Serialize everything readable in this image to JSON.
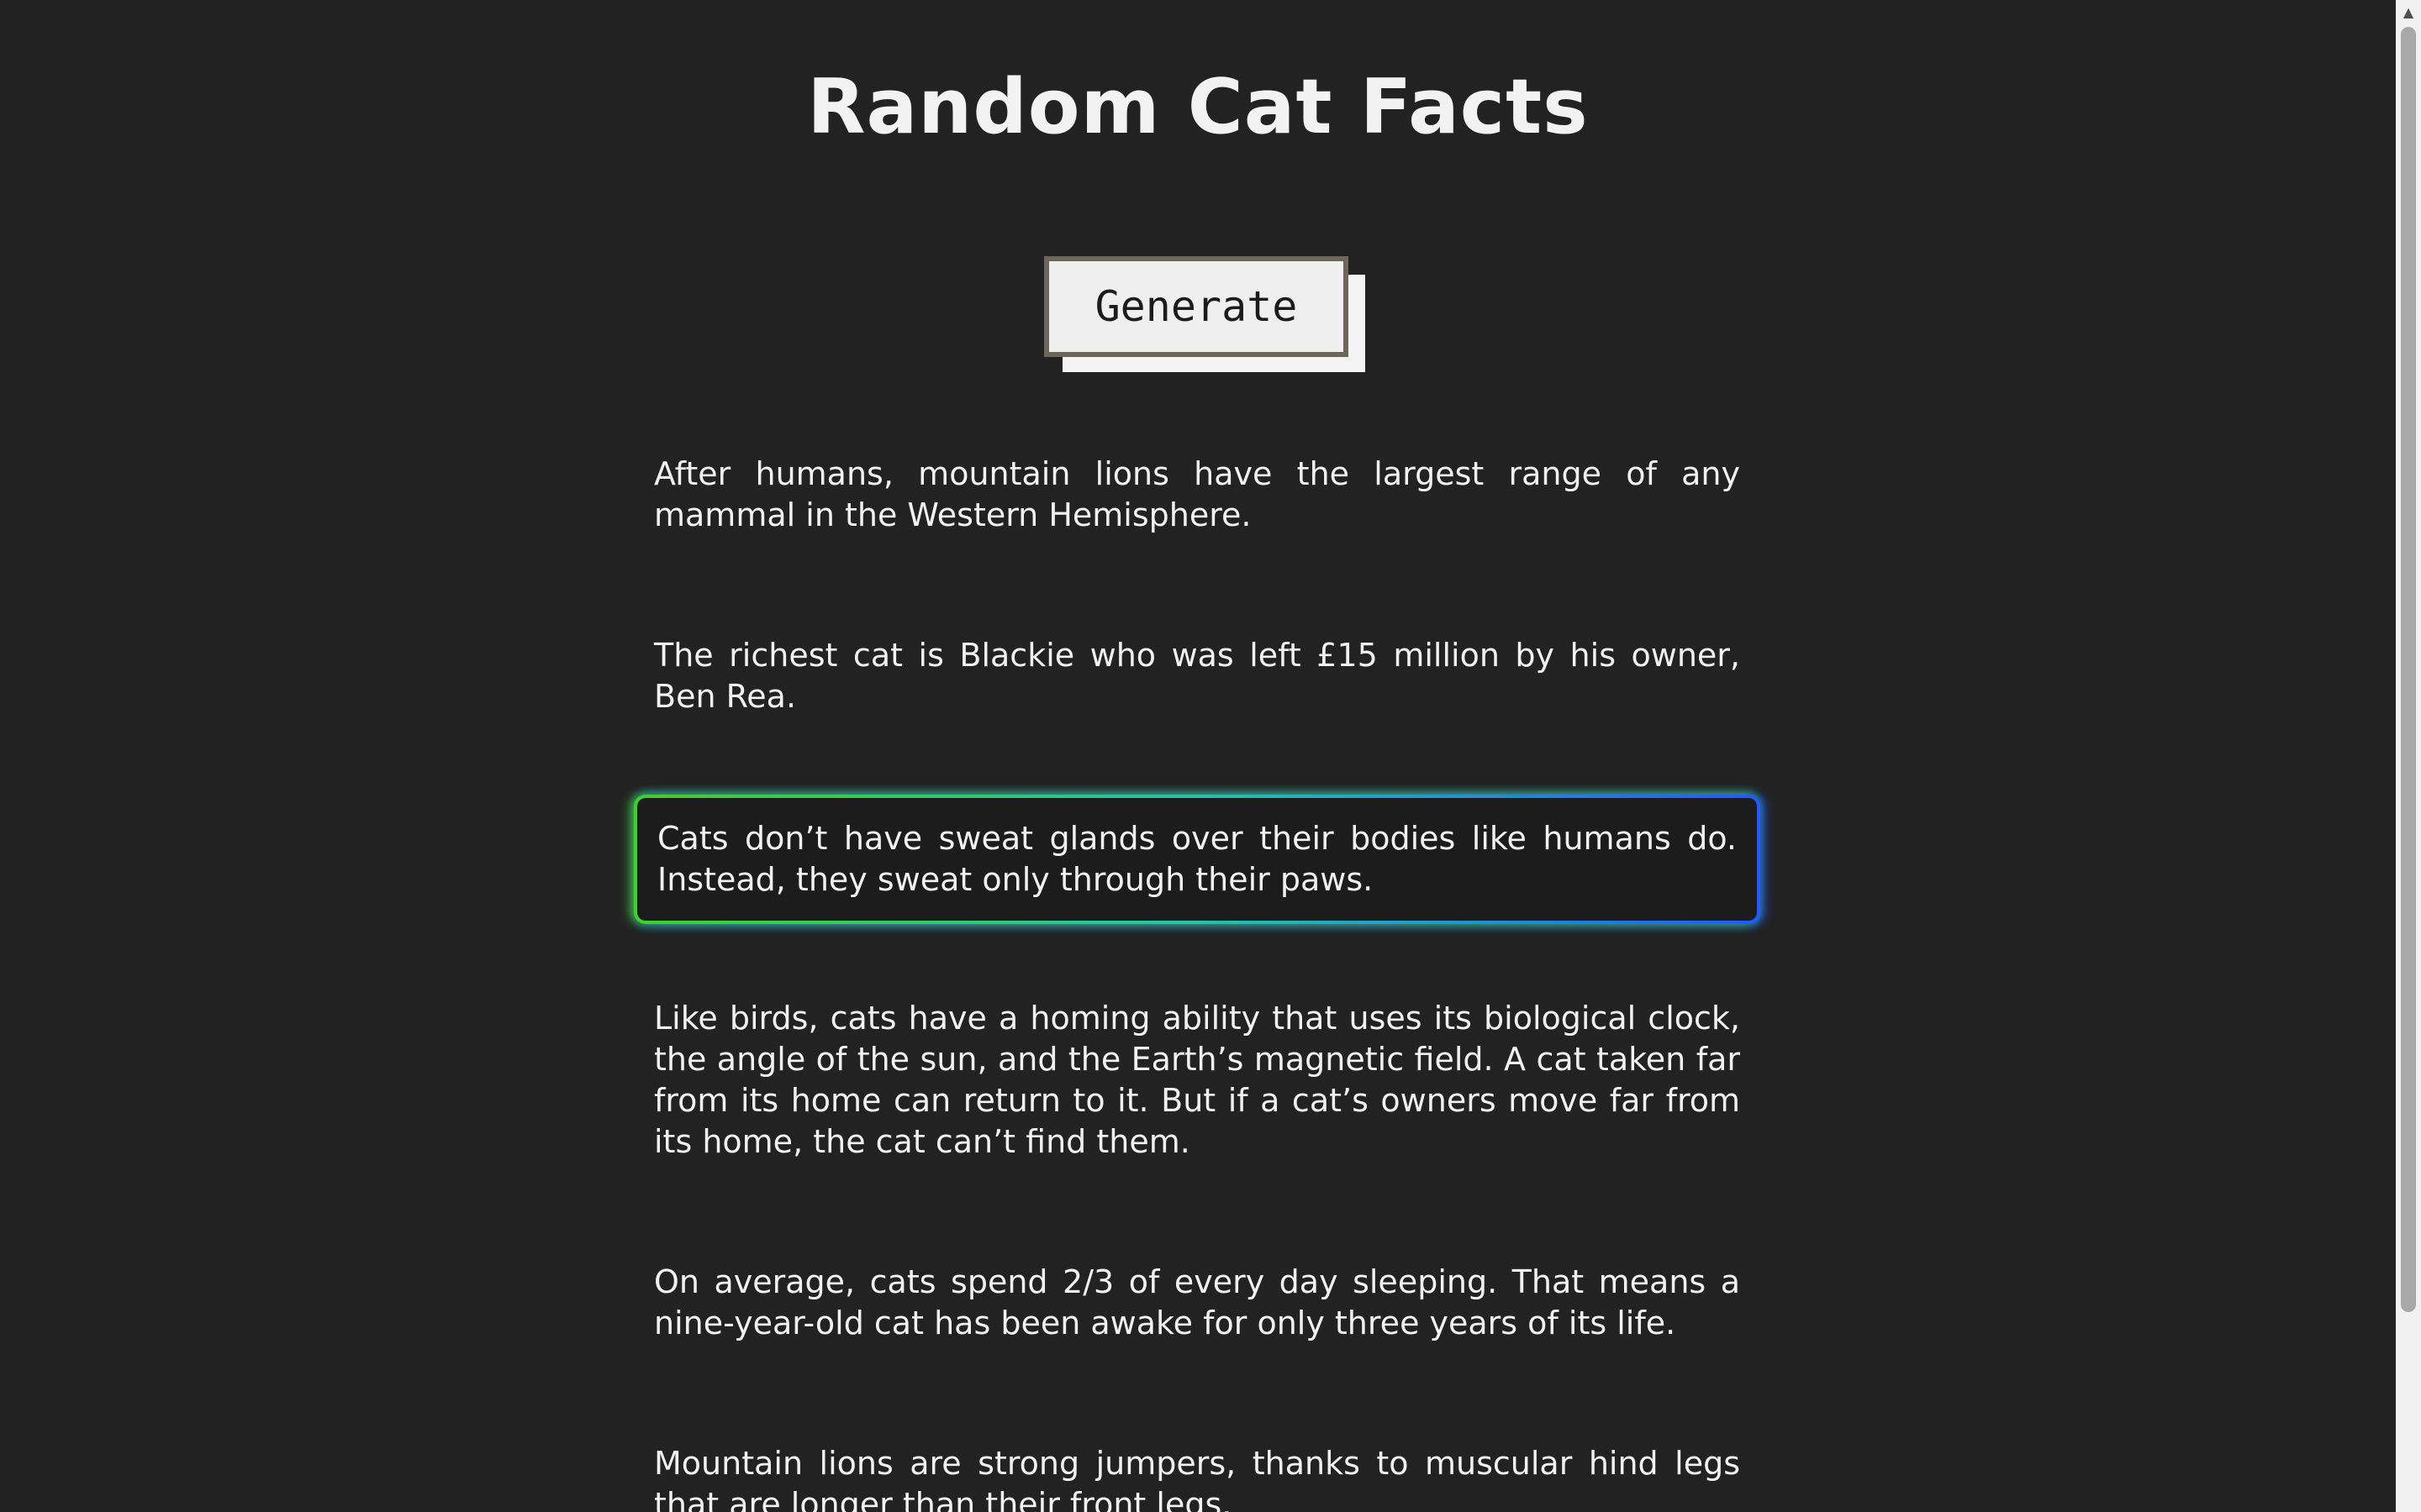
{
  "header": {
    "title": "Random Cat Facts"
  },
  "controls": {
    "generate_label": "Generate"
  },
  "facts": [
    "After humans, mountain lions have the largest range of any mammal in the Western Hemisphere.",
    "The richest cat is Blackie who was left £15 million by his owner, Ben Rea.",
    "Cats don’t have sweat glands over their bodies like humans do. Instead, they sweat only through their paws.",
    "Like birds, cats have a homing ability that uses its biological clock, the angle of the sun, and the Earth’s magnetic field. A cat taken far from its home can return to it. But if a cat’s owners move far from its home, the cat can’t find them.",
    "On average, cats spend 2/3 of every day sleeping. That means a nine-year-old cat has been awake for only three years of its life.",
    "Mountain lions are strong jumpers, thanks to muscular hind legs that are longer than their front legs."
  ],
  "highlighted_fact_index": 2,
  "colors": {
    "background": "#222222",
    "text": "#f1f1f1",
    "button_bg": "#efefef",
    "button_border": "#6d665b",
    "glow_start": "#3fd12a",
    "glow_end": "#1f5bff"
  },
  "icons": {
    "scroll_up": "arrow-up-icon"
  }
}
